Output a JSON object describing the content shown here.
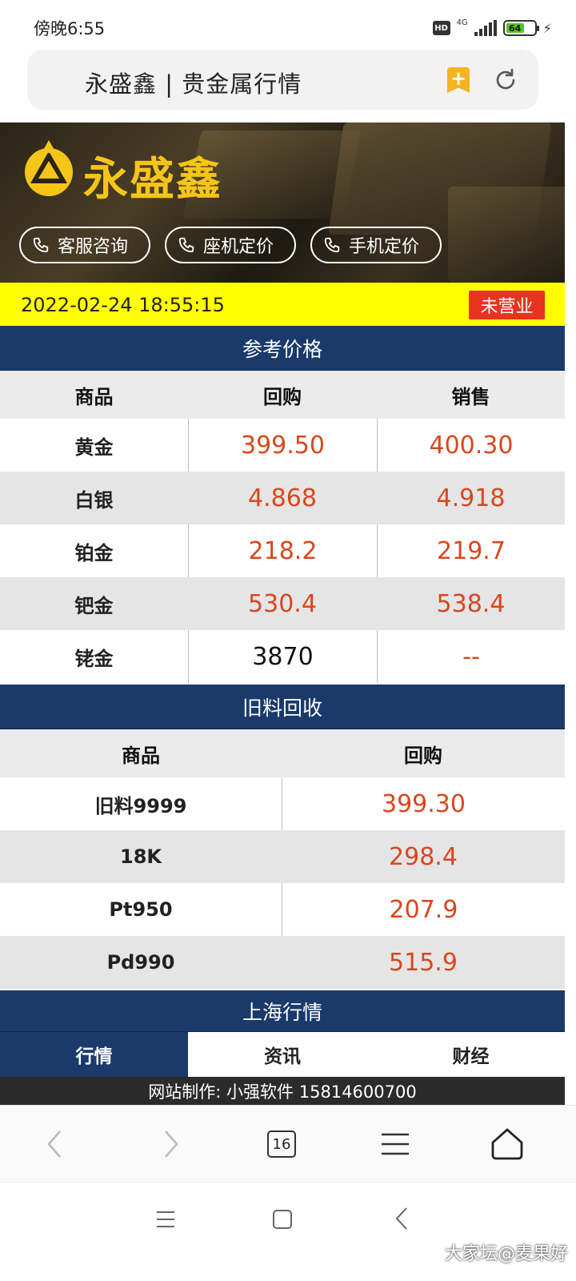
{
  "status_bar": {
    "time": "傍晚6:55",
    "hd": "HD",
    "network": "4G",
    "battery_level": "64",
    "battery_percent": 64
  },
  "url_bar": {
    "title": "永盛鑫 | 贵金属行情"
  },
  "banner": {
    "brand": "永盛鑫",
    "buttons": [
      "客服咨询",
      "座机定价",
      "手机定价"
    ],
    "brand_color": "#f5c518"
  },
  "date_bar": {
    "datetime": "2022-02-24 18:55:15",
    "status_badge": "未营业"
  },
  "reference_prices": {
    "title": "参考价格",
    "headers": [
      "商品",
      "回购",
      "销售"
    ],
    "rows": [
      {
        "name": "黄金",
        "buy": "399.50",
        "sell": "400.30"
      },
      {
        "name": "白银",
        "buy": "4.868",
        "sell": "4.918"
      },
      {
        "name": "铂金",
        "buy": "218.2",
        "sell": "219.7"
      },
      {
        "name": "钯金",
        "buy": "530.4",
        "sell": "538.4"
      },
      {
        "name": "铑金",
        "buy": "3870",
        "sell": "--"
      }
    ]
  },
  "recycle": {
    "title": "旧料回收",
    "headers": [
      "商品",
      "回购"
    ],
    "rows": [
      {
        "name": "旧料9999",
        "buy": "399.30"
      },
      {
        "name": "18K",
        "buy": "298.4"
      },
      {
        "name": "Pt950",
        "buy": "207.9"
      },
      {
        "name": "Pd990",
        "buy": "515.9"
      }
    ]
  },
  "shanghai": {
    "title": "上海行情",
    "tabs": [
      "行情",
      "资讯",
      "财经"
    ],
    "active_tab": 0
  },
  "footer": {
    "text": "网站制作: 小强软件 15814600700"
  },
  "browser_nav": {
    "tab_count": "16"
  },
  "watermark": "大家坛@麦果好",
  "colors": {
    "header_blue": "#1a3a6c",
    "price_red": "#d9471c",
    "date_yellow": "#ffff00",
    "badge_red": "#e8331f"
  }
}
